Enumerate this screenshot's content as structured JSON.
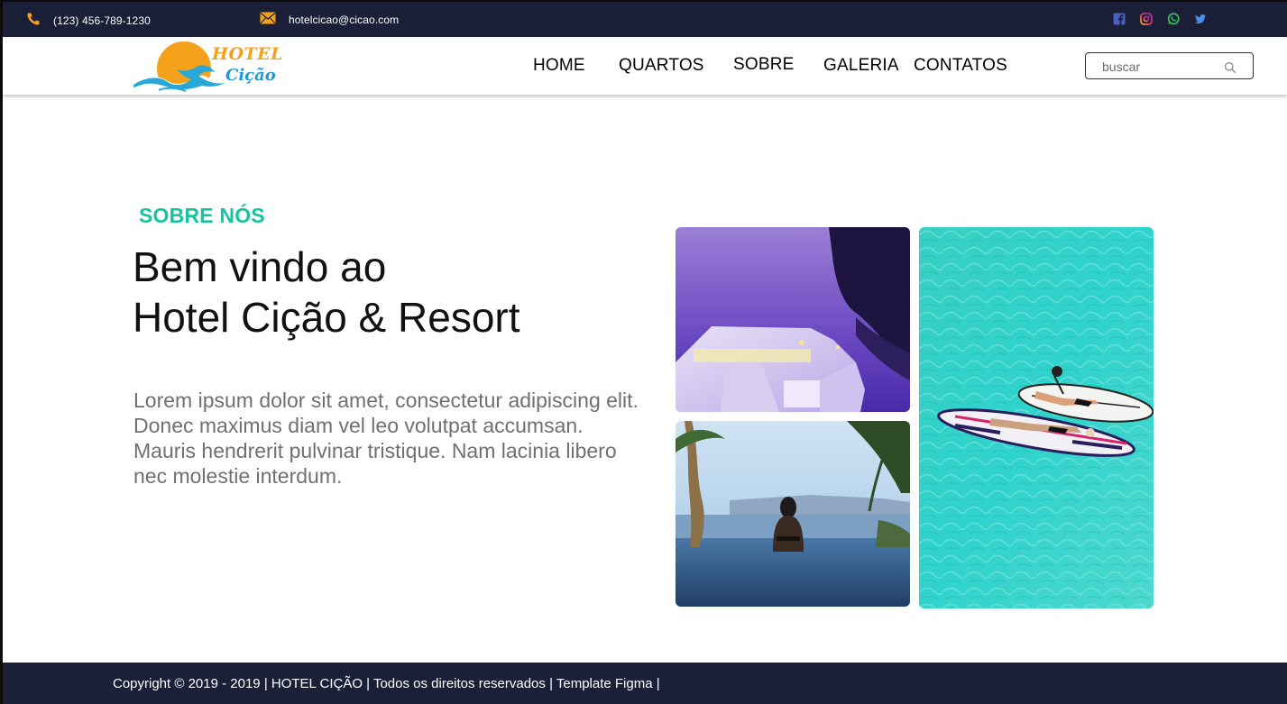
{
  "topbar": {
    "phone": "(123) 456-789-1230",
    "email": "hotelcicao@cicao.com",
    "social_icons": [
      "facebook-icon",
      "instagram-icon",
      "whatsapp-icon",
      "twitter-icon"
    ]
  },
  "header": {
    "logo": {
      "line1": "HOTEL",
      "line2": "Cição"
    },
    "nav": [
      {
        "label": "HOME"
      },
      {
        "label": "QUARTOS"
      },
      {
        "label": "SOBRE"
      },
      {
        "label": "GALERIA"
      },
      {
        "label": "CONTATOS"
      }
    ],
    "search": {
      "placeholder": "buscar"
    }
  },
  "main": {
    "kicker": "SOBRE NÓS",
    "title_line1": "Bem vindo ao",
    "title_line2": "Hotel Cição & Resort",
    "paragraph": "Lorem ipsum dolor sit amet, consectetur adipiscing elit. Donec maximus diam vel leo volutpat accumsan. Mauris hendrerit pulvinar tristique. Nam lacinia libero nec molestie interdum."
  },
  "footer": {
    "copyright": "Copyright © 2019 - 2019 | HOTEL CIÇÃO | Todos os direitos reservados | Template Figma |"
  },
  "colors": {
    "topbar_bg": "#1b2038",
    "accent_teal": "#13c4a3",
    "logo_orange": "#f5a21a",
    "logo_blue": "#1f9ad6"
  }
}
